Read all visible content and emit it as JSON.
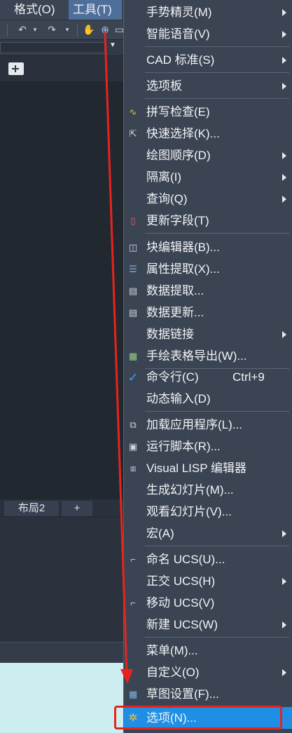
{
  "menubar": {
    "items": [
      "格式(O)",
      "工具(T)"
    ]
  },
  "layout_tabs": [
    "布局2",
    "+"
  ],
  "menu": {
    "items": [
      {
        "label": "手势精灵(M)",
        "submenu": true
      },
      {
        "label": "智能语音(V)",
        "submenu": true
      },
      {
        "label": "CAD 标准(S)",
        "submenu": true
      },
      {
        "label": "选项板",
        "submenu": true
      },
      {
        "label": "拼写检查(E)",
        "icon": "spell-check-icon"
      },
      {
        "label": "快速选择(K)...",
        "icon": "quick-select-icon"
      },
      {
        "label": "绘图顺序(D)",
        "submenu": true
      },
      {
        "label": "隔离(I)",
        "submenu": true
      },
      {
        "label": "查询(Q)",
        "submenu": true
      },
      {
        "label": "更新字段(T)",
        "icon": "update-field-icon"
      },
      {
        "label": "块编辑器(B)...",
        "icon": "block-editor-icon"
      },
      {
        "label": "属性提取(X)...",
        "icon": "attribute-extract-icon"
      },
      {
        "label": "数据提取...",
        "icon": "data-extract-icon"
      },
      {
        "label": "数据更新...",
        "icon": "data-update-icon"
      },
      {
        "label": "数据链接",
        "submenu": true
      },
      {
        "label": "手绘表格导出(W)...",
        "icon": "table-export-icon"
      },
      {
        "label": "命令行(C)",
        "shortcut": "Ctrl+9",
        "icon": "check-mark-icon"
      },
      {
        "label": "动态输入(D)"
      },
      {
        "label": "加载应用程序(L)...",
        "icon": "load-application-icon"
      },
      {
        "label": "运行脚本(R)...",
        "icon": "run-script-icon"
      },
      {
        "label": "Visual LISP 编辑器",
        "icon": "lisp-icon"
      },
      {
        "label": "生成幻灯片(M)..."
      },
      {
        "label": "观看幻灯片(V)..."
      },
      {
        "label": "宏(A)",
        "submenu": true
      },
      {
        "label": "命名 UCS(U)...",
        "icon": "named-ucs-icon"
      },
      {
        "label": "正交 UCS(H)",
        "submenu": true
      },
      {
        "label": "移动 UCS(V)",
        "icon": "move-ucs-icon"
      },
      {
        "label": "新建 UCS(W)",
        "submenu": true
      },
      {
        "label": "菜单(M)..."
      },
      {
        "label": "自定义(O)",
        "submenu": true
      },
      {
        "label": "草图设置(F)...",
        "icon": "drafting-settings-icon"
      },
      {
        "label": "选项(N)...",
        "icon": "gear-icon",
        "highlighted": true
      }
    ]
  },
  "colors": {
    "highlight": "#1f8fe6",
    "annotation": "#e8231e",
    "menu_bg": "#3b4453"
  }
}
